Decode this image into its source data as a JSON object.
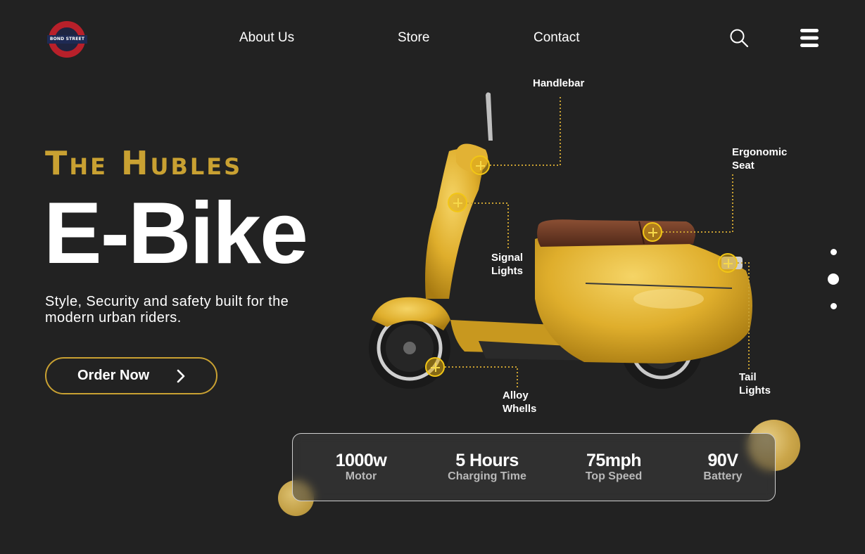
{
  "logo": {
    "text": "BOND STREET"
  },
  "nav": {
    "items": [
      {
        "label": "About Us"
      },
      {
        "label": "Store"
      },
      {
        "label": "Contact"
      }
    ],
    "search_icon": "search-icon",
    "menu_icon": "hamburger-menu-icon"
  },
  "hero": {
    "tagline": "The Hubles",
    "headline": "E-Bike",
    "subtitle": "Style, Security and safety built for the modern urban riders.",
    "cta_label": "Order Now"
  },
  "callouts": {
    "handlebar": "Handlebar",
    "signal_lights": [
      "Signal",
      "Lights"
    ],
    "seat": [
      "Ergonomic",
      "Seat"
    ],
    "tail_lights": [
      "Tail",
      "Lights"
    ],
    "wheels": [
      "Alloy",
      "Whells"
    ]
  },
  "pagination": {
    "count": 3,
    "active_index": 1
  },
  "stats": [
    {
      "value": "1000w",
      "label": "Motor"
    },
    {
      "value": "5 Hours",
      "label": "Charging Time"
    },
    {
      "value": "75mph",
      "label": "Top Speed"
    },
    {
      "value": "90V",
      "label": "Battery"
    }
  ],
  "colors": {
    "background": "#222222",
    "accent_gold": "#c9a132",
    "scooter_yellow": "#e3b52e",
    "hotspot": "#f2c616",
    "seat_brown": "#6b3a24"
  }
}
